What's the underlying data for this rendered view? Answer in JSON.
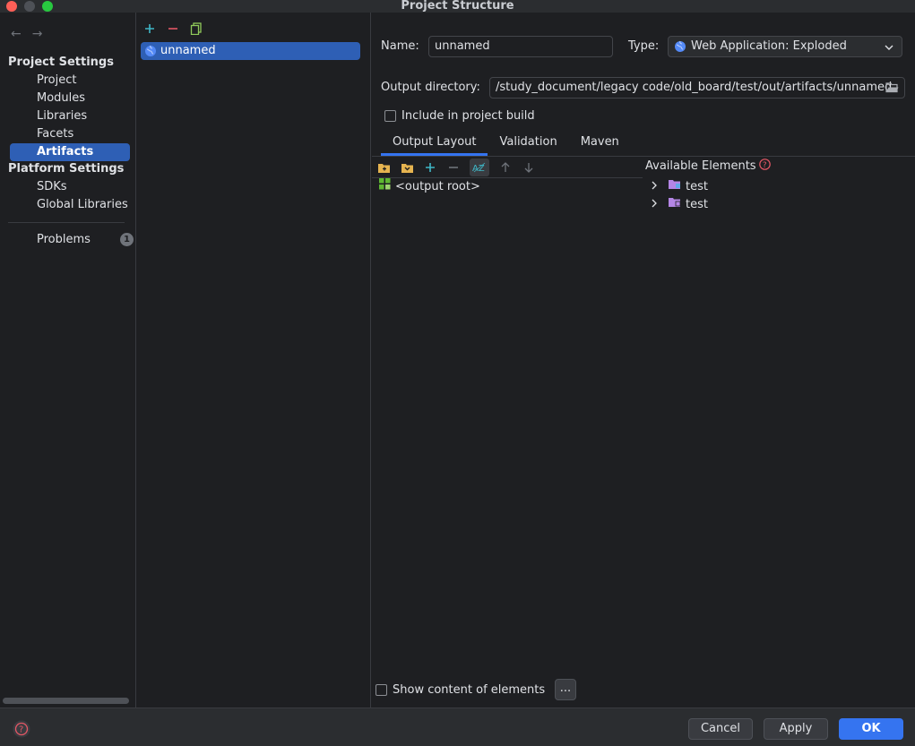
{
  "window": {
    "title": "Project Structure"
  },
  "sidebar": {
    "project_settings": "Project Settings",
    "items_project": [
      "Project",
      "Modules",
      "Libraries",
      "Facets",
      "Artifacts"
    ],
    "platform_settings": "Platform Settings",
    "items_platform": [
      "SDKs",
      "Global Libraries"
    ],
    "problems": {
      "label": "Problems",
      "count": "1"
    },
    "selected": "Artifacts"
  },
  "artifacts": {
    "items": [
      "unnamed"
    ]
  },
  "form": {
    "name_label": "Name:",
    "name_value": "unnamed",
    "type_label": "Type:",
    "type_value": "Web Application: Exploded",
    "output_dir_label": "Output directory:",
    "output_dir_value": "/study_document/legacy code/old_board/test/out/artifacts/unnamed",
    "include_build_label": "Include in project build"
  },
  "tabs": [
    "Output Layout",
    "Validation",
    "Maven"
  ],
  "layout": {
    "tree": [
      "<output root>"
    ],
    "available_title": "Available Elements",
    "available": [
      "test",
      "test"
    ],
    "show_content_label": "Show content of elements",
    "ellipsis": "..."
  },
  "buttons": {
    "cancel": "Cancel",
    "apply": "Apply",
    "ok": "OK"
  },
  "colors": {
    "accent": "#3574f0",
    "selection": "#2e5fb5",
    "background": "#1e1f22"
  }
}
